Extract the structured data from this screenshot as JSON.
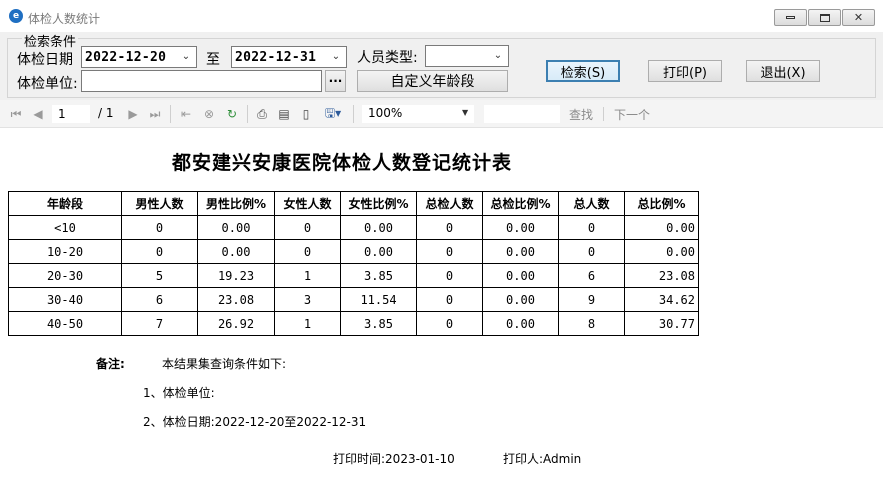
{
  "window": {
    "title": "体检人数统计",
    "controls": [
      "minimize",
      "maximize",
      "close"
    ]
  },
  "search": {
    "group_label": "检索条件",
    "date_label": "体检日期",
    "date_from": "2022-12-20",
    "date_sep": "至",
    "date_to": "2022-12-31",
    "person_type_label": "人员类型:",
    "person_type_value": "",
    "unit_label": "体检单位:",
    "unit_value": "",
    "browse_label": "···",
    "custom_age_button": "自定义年龄段",
    "search_button": "检索(S)",
    "print_button": "打印(P)",
    "exit_button": "退出(X)"
  },
  "toolbar": {
    "current_page": "1",
    "total_pages": "/ 1",
    "zoom": "100%",
    "find_label": "查找",
    "next_label": "下一个",
    "icons": [
      "first-page-icon",
      "prev-page-icon",
      "next-page-icon",
      "last-page-icon",
      "back-icon",
      "stop-icon",
      "refresh-icon",
      "print-icon",
      "page-layout-icon",
      "page-setup-icon",
      "export-icon"
    ]
  },
  "report": {
    "title": "都安建兴安康医院体检人数登记统计表",
    "columns": [
      "年龄段",
      "男性人数",
      "男性比例%",
      "女性人数",
      "女性比例%",
      "总检人数",
      "总检比例%",
      "总人数",
      "总比例%"
    ],
    "rows": [
      [
        "<10",
        "0",
        "0.00",
        "0",
        "0.00",
        "0",
        "0.00",
        "0",
        "0.00"
      ],
      [
        "10-20",
        "0",
        "0.00",
        "0",
        "0.00",
        "0",
        "0.00",
        "0",
        "0.00"
      ],
      [
        "20-30",
        "5",
        "19.23",
        "1",
        "3.85",
        "0",
        "0.00",
        "6",
        "23.08"
      ],
      [
        "30-40",
        "6",
        "23.08",
        "3",
        "11.54",
        "0",
        "0.00",
        "9",
        "34.62"
      ],
      [
        "40-50",
        "7",
        "26.92",
        "1",
        "3.85",
        "0",
        "0.00",
        "8",
        "30.77"
      ]
    ],
    "note_label": "备注:",
    "note_intro": "本结果集查询条件如下:",
    "note_item1": "1、体检单位:",
    "note_item2": "2、体检日期:2022-12-20至2022-12-31",
    "print_time": "打印时间:2023-01-10",
    "printer": "打印人:Admin"
  }
}
